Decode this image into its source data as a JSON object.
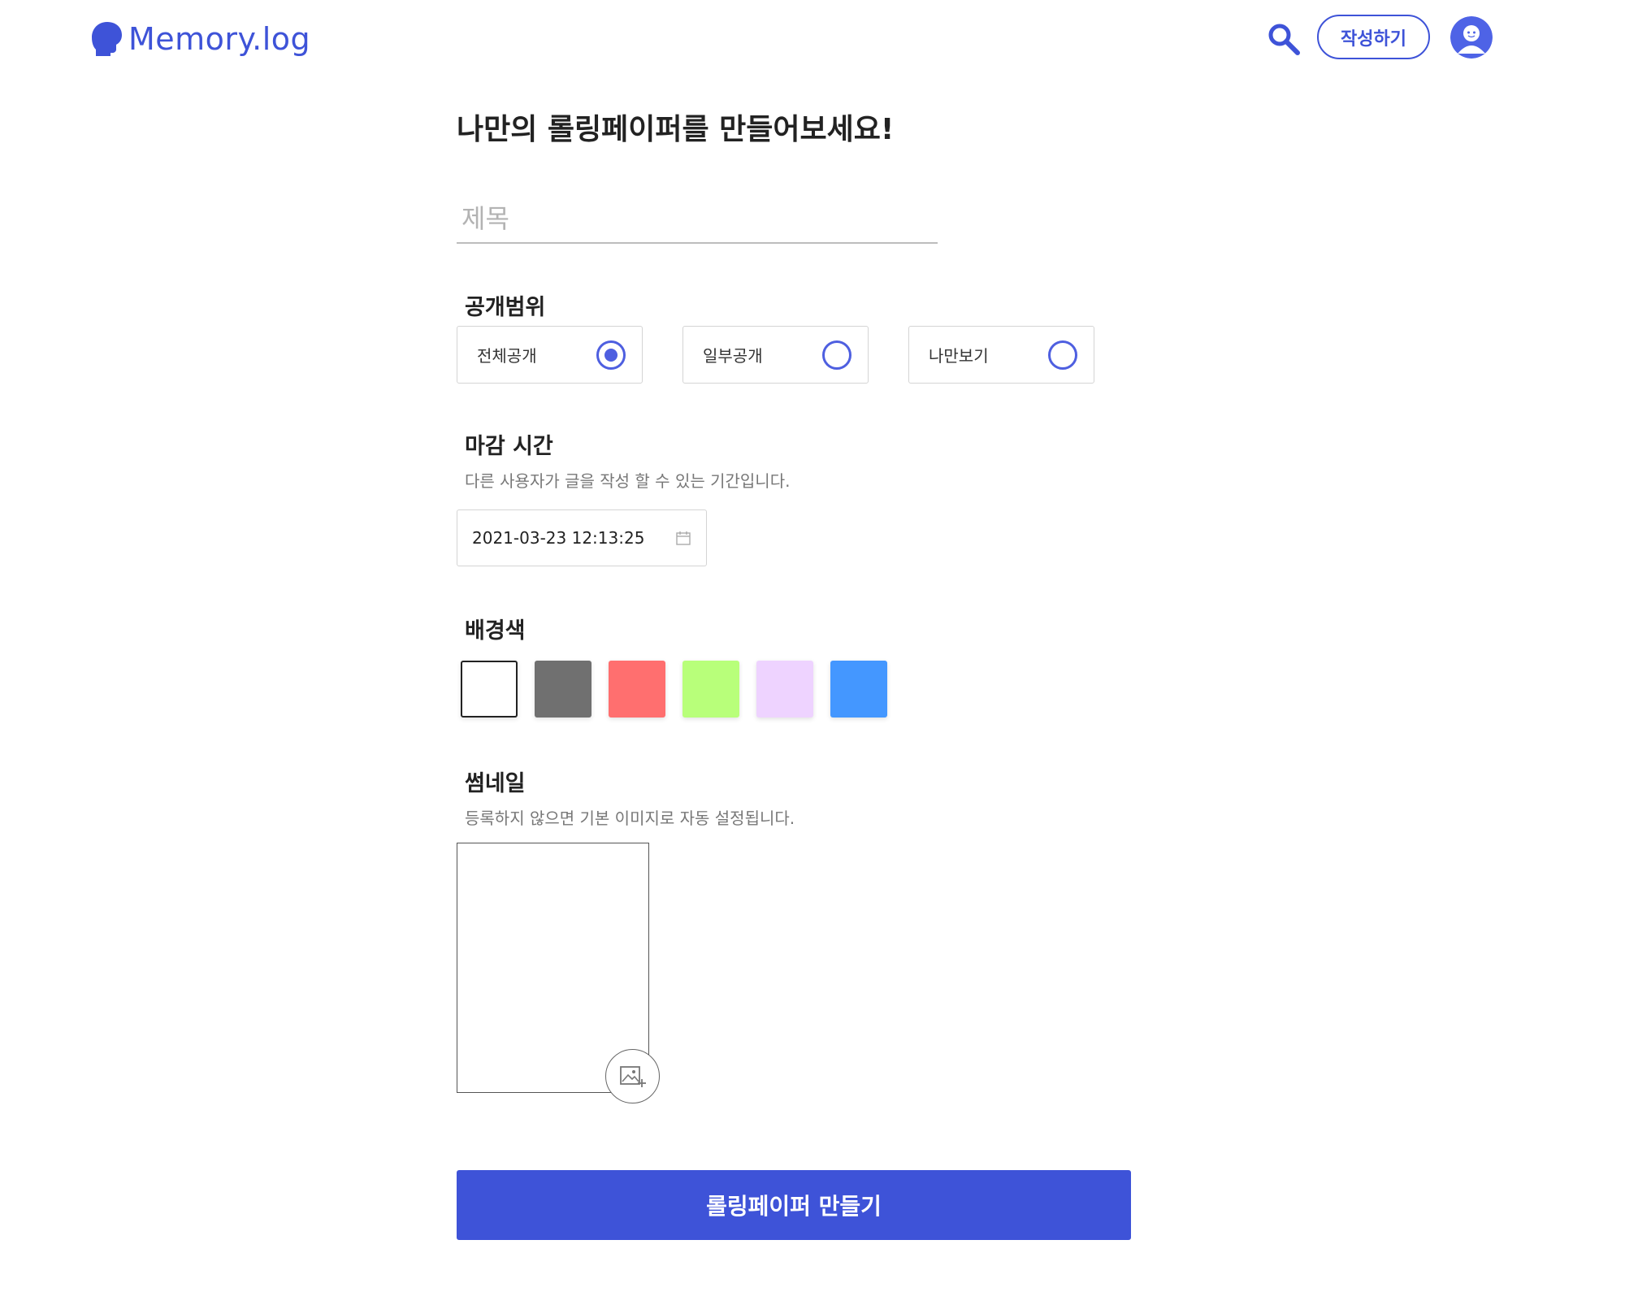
{
  "header": {
    "logo_text": "Memory.log",
    "search_icon": "search-icon",
    "write_button": "작성하기",
    "avatar_icon": "user-avatar-icon"
  },
  "form": {
    "title": "나만의 롤링페이퍼를 만들어보세요!",
    "title_input": {
      "placeholder": "제목",
      "value": ""
    },
    "visibility": {
      "label": "공개범위",
      "options": [
        {
          "label": "전체공개",
          "selected": true
        },
        {
          "label": "일부공개",
          "selected": false
        },
        {
          "label": "나만보기",
          "selected": false
        }
      ]
    },
    "deadline": {
      "label": "마감 시간",
      "hint": "다른 사용자가 글을 작성 할 수 있는 기간입니다.",
      "value": "2021-03-23 12:13:25",
      "icon": "calendar-icon"
    },
    "background": {
      "label": "배경색",
      "colors": [
        "#ffffff",
        "#707070",
        "#ff6f6f",
        "#b8ff7a",
        "#eed3ff",
        "#4497ff"
      ],
      "selected_index": 0
    },
    "thumbnail": {
      "label": "썸네일",
      "hint": "등록하지 않으면 기본 이미지로 자동 설정됩니다.",
      "upload_icon": "add-image-icon"
    },
    "submit_button": "롤링페이퍼 만들기"
  },
  "colors": {
    "accent": "#3e53d8",
    "radio": "#4e5fe0"
  }
}
